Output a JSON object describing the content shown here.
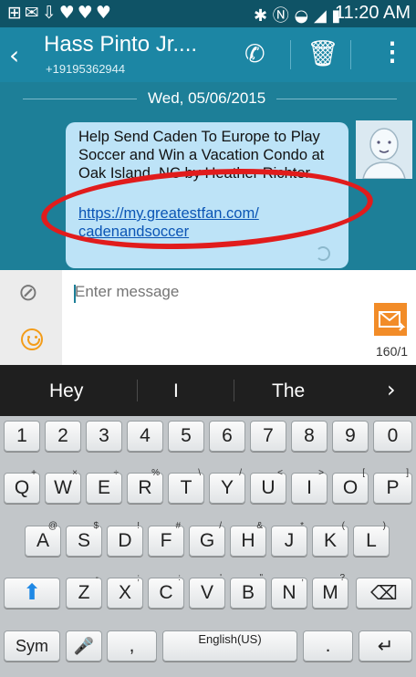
{
  "statusbar": {
    "left_icons": "⊞✉⇩♥♥♥",
    "right_icons": "✱ Ⓝ ◒ ◢ ▮",
    "time": "11:20 AM"
  },
  "header": {
    "back": "‹",
    "contact_name": "Hass Pinto Jr....",
    "phone": "+19195362944",
    "call_icon": "✆",
    "delete_icon": "🗑",
    "more_icon": "⋮"
  },
  "conversation": {
    "date": "Wed, 05/06/2015",
    "message": "Help Send Caden To Europe to Play Soccer and Win a Vacation Condo at Oak Island, NC by Heather Richter",
    "link": "https://my.greatestfan.com/ cadenandsoccer"
  },
  "compose": {
    "placeholder": "Enter message",
    "counter": "160/1"
  },
  "suggestions": [
    "Hey",
    "I",
    "The"
  ],
  "suggest_arrow": "›",
  "keyboard": {
    "row1": [
      "1",
      "2",
      "3",
      "4",
      "5",
      "6",
      "7",
      "8",
      "9",
      "0"
    ],
    "row2": [
      {
        "k": "Q",
        "s": "+"
      },
      {
        "k": "W",
        "s": "×"
      },
      {
        "k": "E",
        "s": "÷"
      },
      {
        "k": "R",
        "s": "%"
      },
      {
        "k": "T",
        "s": "\\"
      },
      {
        "k": "Y",
        "s": "/"
      },
      {
        "k": "U",
        "s": "<"
      },
      {
        "k": "I",
        "s": ">"
      },
      {
        "k": "O",
        "s": "["
      },
      {
        "k": "P",
        "s": "]"
      }
    ],
    "row3": [
      {
        "k": "A",
        "s": "@"
      },
      {
        "k": "S",
        "s": "$"
      },
      {
        "k": "D",
        "s": "!"
      },
      {
        "k": "F",
        "s": "#"
      },
      {
        "k": "G",
        "s": "/"
      },
      {
        "k": "H",
        "s": "&"
      },
      {
        "k": "J",
        "s": "*"
      },
      {
        "k": "K",
        "s": "("
      },
      {
        "k": "L",
        "s": ")"
      }
    ],
    "row4": [
      {
        "k": "Z",
        "s": "-"
      },
      {
        "k": "X",
        "s": ";"
      },
      {
        "k": "C",
        "s": ":"
      },
      {
        "k": "V",
        "s": "'"
      },
      {
        "k": "B",
        "s": "\""
      },
      {
        "k": "N",
        "s": ","
      },
      {
        "k": "M",
        "s": "?"
      }
    ],
    "shift": "⬆",
    "backspace": "⌫",
    "sym": "Sym",
    "mic": "🎤",
    "comma": ",",
    "space_label": "English(US)",
    "period": ".",
    "enter": "↵"
  },
  "colors": {
    "accent": "#1c86a4",
    "bubble": "#bde3f7",
    "highlight_ring": "#e11c1c",
    "send": "#f28c28"
  }
}
